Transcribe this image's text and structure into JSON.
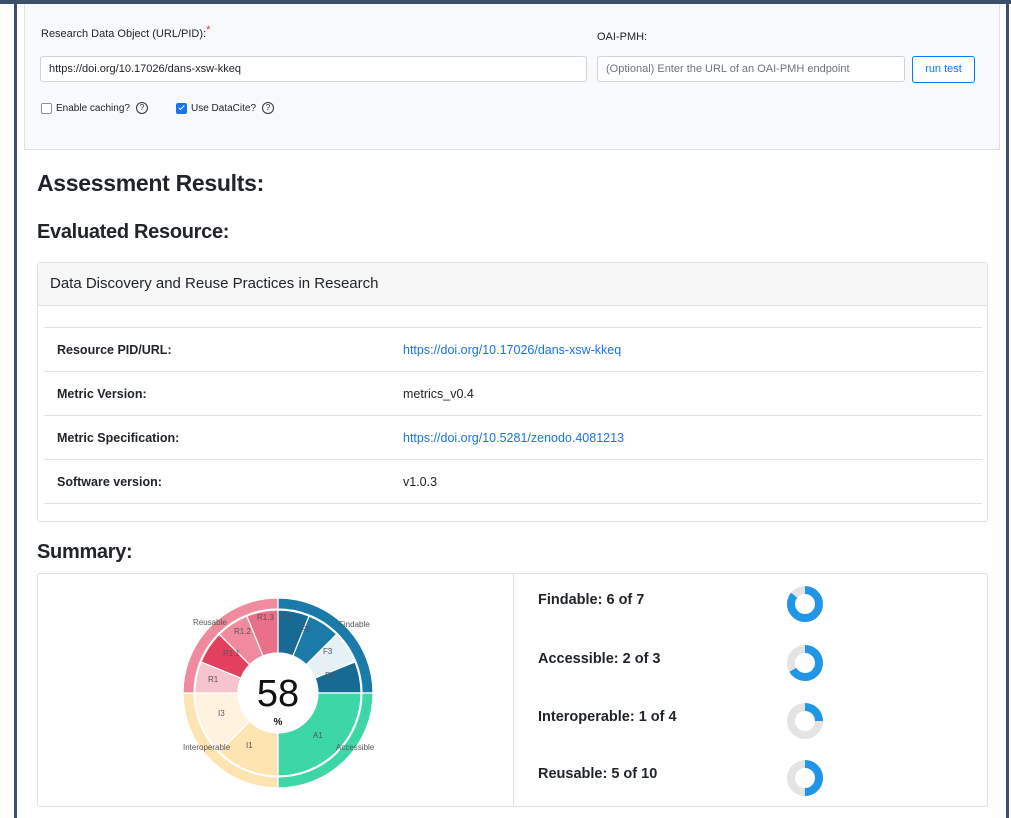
{
  "form": {
    "rdo_label": "Research Data Object (URL/PID):",
    "required_mark": "*",
    "rdo_value": "https://doi.org/10.17026/dans-xsw-kkeq",
    "oai_label": "OAI-PMH:",
    "oai_placeholder": "(Optional) Enter the URL of an OAI-PMH endpoint",
    "run_test_label": "run test",
    "caching_label": "Enable caching?",
    "caching_checked": false,
    "datacite_label": "Use DataCite?",
    "datacite_checked": true,
    "help_glyph": "?"
  },
  "results": {
    "heading": "Assessment Results:",
    "evaluated_heading": "Evaluated Resource:",
    "resource_title": "Data Discovery and Reuse Practices in Research",
    "rows": [
      {
        "key": "Resource PID/URL:",
        "value": "https://doi.org/10.17026/dans-xsw-kkeq",
        "is_link": true
      },
      {
        "key": "Metric Version:",
        "value": "metrics_v0.4",
        "is_link": false
      },
      {
        "key": "Metric Specification:",
        "value": "https://doi.org/10.5281/zenodo.4081213",
        "is_link": true
      },
      {
        "key": "Software version:",
        "value": "v1.0.3",
        "is_link": false
      }
    ]
  },
  "summary": {
    "heading": "Summary:",
    "score_value": "58",
    "score_unit": "%",
    "categories": [
      {
        "label": "Findable: 6 of 7",
        "earned": 6,
        "total": 7
      },
      {
        "label": "Accessible: 2 of 3",
        "earned": 2,
        "total": 3
      },
      {
        "label": "Interoperable: 1 of 4",
        "earned": 1,
        "total": 4
      },
      {
        "label": "Reusable: 5 of 10",
        "earned": 5,
        "total": 10
      }
    ],
    "ring_labels": {
      "findable": "Findable",
      "accessible": "Accessible",
      "interoperable": "Interoperable",
      "reusable": "Reusable",
      "f1": "F1",
      "f2": "F2",
      "f3": "F3",
      "f4": "F4",
      "a1": "A1",
      "i1": "I1",
      "i3": "I3",
      "r1": "R1",
      "r1_1": "R1.1",
      "r1_2": "R1.2",
      "r1_3": "R1.3"
    },
    "colors": {
      "findable": "#1a7aa8",
      "accessible": "#3dd6a5",
      "interoperable": "#fde4b0",
      "reusable": "#f08a9f",
      "donut_fill": "#2196e8",
      "donut_track": "#e4e4e4"
    }
  }
}
